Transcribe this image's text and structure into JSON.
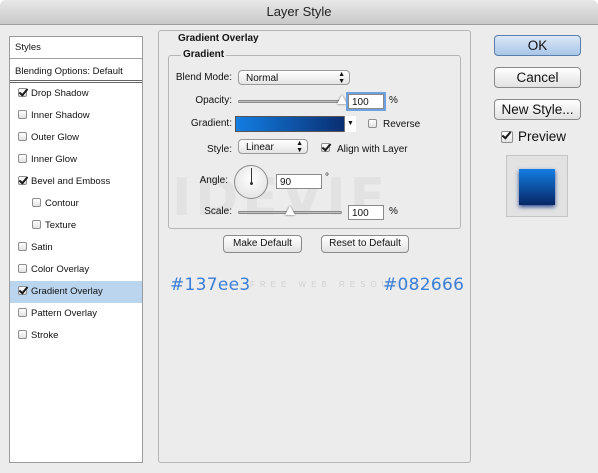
{
  "window": {
    "title": "Layer Style"
  },
  "styles_list": {
    "header": "Styles",
    "blending": "Blending Options: Default",
    "items": [
      {
        "label": "Drop Shadow",
        "checked": true,
        "indent": false,
        "selected": false
      },
      {
        "label": "Inner Shadow",
        "checked": false,
        "indent": false,
        "selected": false
      },
      {
        "label": "Outer Glow",
        "checked": false,
        "indent": false,
        "selected": false
      },
      {
        "label": "Inner Glow",
        "checked": false,
        "indent": false,
        "selected": false
      },
      {
        "label": "Bevel and Emboss",
        "checked": true,
        "indent": false,
        "selected": false
      },
      {
        "label": "Contour",
        "checked": false,
        "indent": true,
        "selected": false
      },
      {
        "label": "Texture",
        "checked": false,
        "indent": true,
        "selected": false
      },
      {
        "label": "Satin",
        "checked": false,
        "indent": false,
        "selected": false
      },
      {
        "label": "Color Overlay",
        "checked": false,
        "indent": false,
        "selected": false
      },
      {
        "label": "Gradient Overlay",
        "checked": true,
        "indent": false,
        "selected": true
      },
      {
        "label": "Pattern Overlay",
        "checked": false,
        "indent": false,
        "selected": false
      },
      {
        "label": "Stroke",
        "checked": false,
        "indent": false,
        "selected": false
      }
    ]
  },
  "panel": {
    "title": "Gradient Overlay",
    "group_title": "Gradient",
    "blend_mode": {
      "label": "Blend Mode:",
      "value": "Normal"
    },
    "opacity": {
      "label": "Opacity:",
      "value": "100",
      "unit": "%",
      "level": 1.0
    },
    "gradient": {
      "label": "Gradient:",
      "start_color": "#137ee3",
      "end_color": "#082666"
    },
    "reverse": {
      "label": "Reverse",
      "checked": false
    },
    "style": {
      "label": "Style:",
      "value": "Linear"
    },
    "align": {
      "label": "Align with Layer",
      "checked": true
    },
    "angle": {
      "label": "Angle:",
      "value": "90",
      "unit": "°"
    },
    "scale": {
      "label": "Scale:",
      "value": "100",
      "unit": "%",
      "level": 0.5
    },
    "make_default": "Make Default",
    "reset_default": "Reset to Default"
  },
  "annotations": {
    "left_hex": "#137ee3",
    "right_hex": "#082666"
  },
  "watermark": {
    "text": "IDEVIE",
    "subtext": "FREE WEB RESOURCES"
  },
  "actions": {
    "ok": "OK",
    "cancel": "Cancel",
    "new_style": "New Style...",
    "preview": "Preview",
    "preview_checked": true
  },
  "accent_color": "#bcd5ef"
}
